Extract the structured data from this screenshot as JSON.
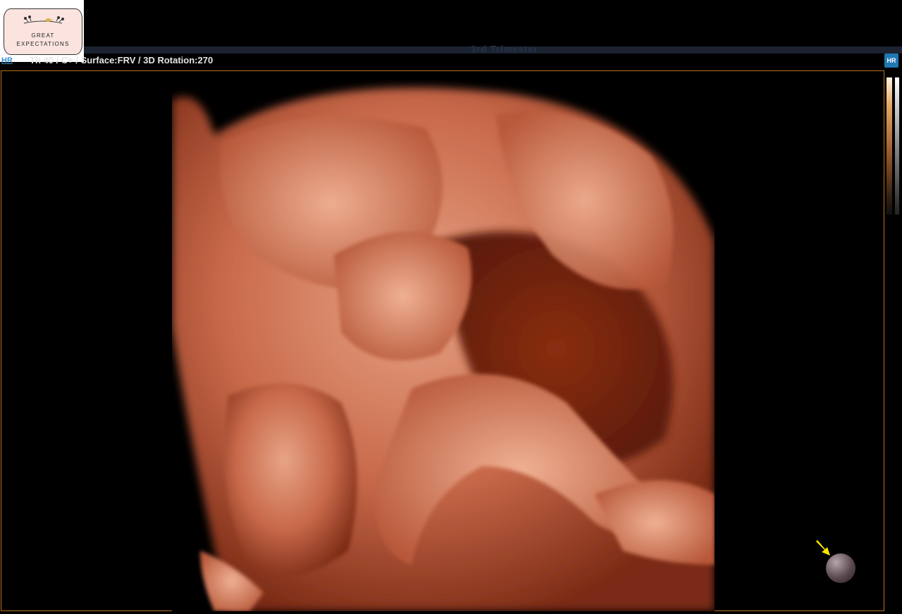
{
  "logo": {
    "line1": "GREAT",
    "line2": "EXPECTATIONS",
    "card_color": "#fbe4df"
  },
  "header": {
    "title": "3rd Trimester"
  },
  "status": {
    "tag": "HR",
    "text": "Th 40 / C+ / Surface:FRV / 3D Rotation:270"
  },
  "hr_badge": {
    "label": "HR"
  },
  "colors": {
    "frame": "#b8701e",
    "skin": "#d98a68",
    "accent": "#1f78b4",
    "arrow": "#ffe600"
  },
  "icons": {
    "orientation": "orientation-ball-icon",
    "pointer": "yellow-arrow-icon"
  }
}
